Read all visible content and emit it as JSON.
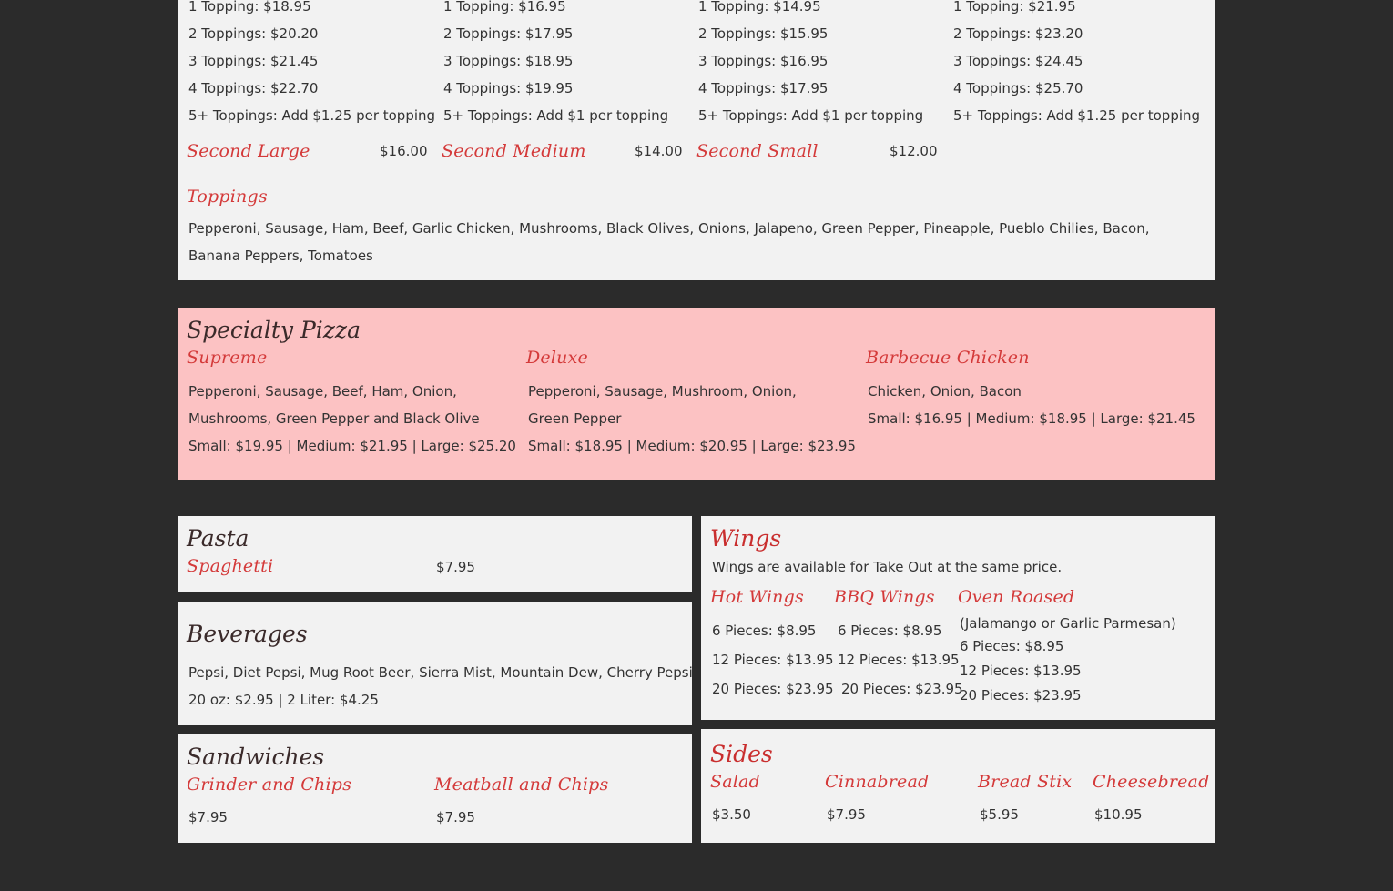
{
  "pizza_prices": {
    "columns": [
      {
        "one": "1 Topping: $18.95",
        "two": "2 Toppings: $20.20",
        "three": "3 Toppings: $21.45",
        "four": "4 Toppings: $22.70",
        "five": "5+ Toppings: Add $1.25 per topping"
      },
      {
        "one": "1 Topping: $16.95",
        "two": "2 Toppings: $17.95",
        "three": "3 Toppings: $18.95",
        "four": "4 Toppings: $19.95",
        "five": "5+ Toppings: Add $1 per topping"
      },
      {
        "one": "1 Topping: $14.95",
        "two": "2 Toppings: $15.95",
        "three": "3 Toppings: $16.95",
        "four": "4 Toppings: $17.95",
        "five": "5+ Toppings: Add $1 per topping"
      },
      {
        "one": "1 Topping: $21.95",
        "two": "2 Toppings: $23.20",
        "three": "3 Toppings: $24.45",
        "four": "4 Toppings: $25.70",
        "five": "5+ Toppings: Add $1.25 per topping"
      }
    ],
    "seconds": [
      {
        "name": "Second Large",
        "price": "$16.00"
      },
      {
        "name": "Second Medium",
        "price": "$14.00"
      },
      {
        "name": "Second Small",
        "price": "$12.00"
      }
    ],
    "toppings_title": "Toppings",
    "toppings_list": "Pepperoni, Sausage, Ham, Beef, Garlic Chicken, Mushrooms, Black Olives, Onions, Jalapeno, Green Pepper, Pineapple, Pueblo Chilies, Bacon, Banana Peppers, Tomatoes"
  },
  "specialty": {
    "title": "Specialty Pizza",
    "items": [
      {
        "name": "Supreme",
        "desc": "Pepperoni, Sausage, Beef, Ham, Onion, Mushrooms, Green Pepper and Black Olive",
        "prices": "Small: $19.95 | Medium: $21.95 | Large: $25.20"
      },
      {
        "name": "Deluxe",
        "desc": "Pepperoni, Sausage, Mushroom, Onion, Green Pepper",
        "prices": "Small: $18.95 | Medium: $20.95 | Large: $23.95"
      },
      {
        "name": "Barbecue Chicken",
        "desc": "Chicken, Onion, Bacon",
        "prices": "Small: $16.95 | Medium: $18.95 |  Large: $21.45"
      }
    ]
  },
  "pasta": {
    "title": "Pasta",
    "item": "Spaghetti",
    "price": "$7.95"
  },
  "beverages": {
    "title": "Beverages",
    "list": "Pepsi, Diet Pepsi, Mug Root Beer, Sierra Mist, Mountain Dew, Cherry Pepsi",
    "prices": "20 oz: $2.95 | 2 Liter: $4.25"
  },
  "sandwiches": {
    "title": "Sandwiches",
    "items": [
      {
        "name": "Grinder and Chips",
        "price": "$7.95"
      },
      {
        "name": "Meatball and Chips",
        "price": "$7.95"
      }
    ]
  },
  "wings": {
    "title": "Wings",
    "note": "Wings are available for Take Out at the same price.",
    "hot": {
      "name": "Hot Wings",
      "p6": "6 Pieces: $8.95",
      "p12": "12 Pieces: $13.95",
      "p20": "20 Pieces: $23.95"
    },
    "bbq": {
      "name": "BBQ Wings",
      "p6": "6 Pieces: $8.95",
      "p12": "12 Pieces: $13.95",
      "p20": "20 Pieces: $23.95"
    },
    "oven": {
      "name": "Oven Roased",
      "flavors": "(Jalamango or Garlic Parmesan)",
      "p6": "6 Pieces: $8.95",
      "p12": "12 Pieces: $13.95",
      "p20": "20 Pieces: $23.95"
    }
  },
  "sides": {
    "title": "Sides",
    "items": [
      {
        "name": "Salad",
        "price": "$3.50"
      },
      {
        "name": "Cinnabread",
        "price": "$7.95"
      },
      {
        "name": "Bread Stix",
        "price": "$5.95"
      },
      {
        "name": "Cheesebread",
        "price": "$10.95"
      }
    ]
  }
}
